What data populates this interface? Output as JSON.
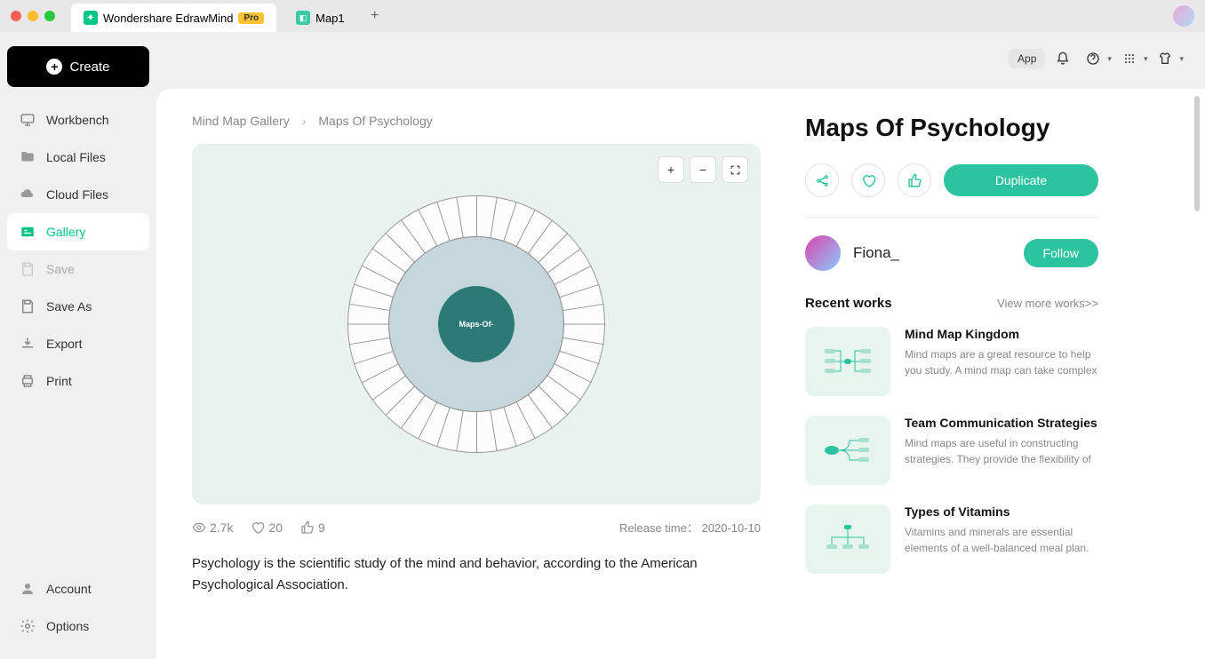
{
  "titlebar": {
    "tabs": [
      {
        "label": "Wondershare EdrawMind",
        "badge": "Pro"
      },
      {
        "label": "Map1"
      }
    ]
  },
  "toolbar": {
    "app_label": "App"
  },
  "sidebar": {
    "create_label": "Create",
    "items": [
      {
        "key": "workbench",
        "label": "Workbench"
      },
      {
        "key": "local-files",
        "label": "Local Files"
      },
      {
        "key": "cloud-files",
        "label": "Cloud Files"
      },
      {
        "key": "gallery",
        "label": "Gallery"
      },
      {
        "key": "save",
        "label": "Save"
      },
      {
        "key": "save-as",
        "label": "Save As"
      },
      {
        "key": "export",
        "label": "Export"
      },
      {
        "key": "print",
        "label": "Print"
      }
    ],
    "bottom": [
      {
        "key": "account",
        "label": "Account"
      },
      {
        "key": "options",
        "label": "Options"
      }
    ]
  },
  "breadcrumb": {
    "root": "Mind Map Gallery",
    "current": "Maps Of Psychology"
  },
  "preview": {
    "core_label": "Maps-Of-"
  },
  "stats": {
    "views": "2.7k",
    "likes": "20",
    "thumbs": "9",
    "release_label": "Release time：",
    "release_date": "2020-10-10"
  },
  "description": "Psychology is the scientific study of the mind and behavior, according to the American Psychological Association.",
  "detail": {
    "title": "Maps Of Psychology",
    "duplicate_label": "Duplicate",
    "author": "Fiona_",
    "follow_label": "Follow"
  },
  "recent": {
    "heading": "Recent works",
    "view_more": "View more works>>",
    "works": [
      {
        "title": "Mind Map Kingdom",
        "desc": "Mind maps are a great resource to help you study. A mind map can take complex"
      },
      {
        "title": "Team Communication Strategies",
        "desc": "Mind maps are useful in constructing strategies. They provide the flexibility of"
      },
      {
        "title": "Types of Vitamins",
        "desc": "Vitamins and minerals are essential elements of a well-balanced meal plan."
      }
    ]
  }
}
